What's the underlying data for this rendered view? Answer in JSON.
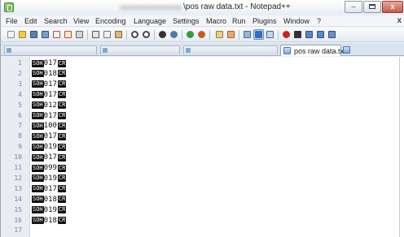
{
  "window": {
    "title": "\\pos raw data.txt - Notepad++",
    "controls": {
      "minimize": "–",
      "close": "x"
    }
  },
  "menu": {
    "items": [
      "File",
      "Edit",
      "Search",
      "View",
      "Encoding",
      "Language",
      "Settings",
      "Macro",
      "Run",
      "Plugins",
      "Window",
      "?"
    ],
    "doc_close": "x"
  },
  "toolbar": {
    "icons": [
      "new-file-icon",
      "open-file-icon",
      "save-icon",
      "save-all-icon",
      "close-icon",
      "close-all-icon",
      "print-icon",
      "cut-icon",
      "copy-icon",
      "paste-icon",
      "undo-icon",
      "redo-icon",
      "find-icon",
      "replace-icon",
      "zoom-in-icon",
      "zoom-out-icon",
      "sync-vertical-icon",
      "sync-horizontal-icon",
      "word-wrap-icon",
      "show-all-characters-icon",
      "indent-guide-icon",
      "record-macro-icon",
      "stop-record-icon",
      "play-macro-icon",
      "run-macro-multiple-icon",
      "save-macro-icon"
    ],
    "active_icon": "show-all-characters-icon",
    "colors": {
      "record": "#d42020",
      "accent": "#2f6fbf"
    }
  },
  "tabs": {
    "active_label": "pos raw data.txt"
  },
  "editor": {
    "control_chars": {
      "start": "SOH",
      "end": "CR"
    },
    "lines": [
      {
        "no": "1",
        "value": "017"
      },
      {
        "no": "2",
        "value": "018"
      },
      {
        "no": "3",
        "value": "017"
      },
      {
        "no": "4",
        "value": "017"
      },
      {
        "no": "5",
        "value": "012"
      },
      {
        "no": "6",
        "value": "017"
      },
      {
        "no": "7",
        "value": "100"
      },
      {
        "no": "8",
        "value": "017"
      },
      {
        "no": "9",
        "value": "019"
      },
      {
        "no": "10",
        "value": "017"
      },
      {
        "no": "11",
        "value": "099"
      },
      {
        "no": "12",
        "value": "019"
      },
      {
        "no": "13",
        "value": "017"
      },
      {
        "no": "14",
        "value": "018"
      },
      {
        "no": "15",
        "value": "019"
      },
      {
        "no": "16",
        "value": "018"
      },
      {
        "no": "17",
        "value": ""
      }
    ]
  }
}
